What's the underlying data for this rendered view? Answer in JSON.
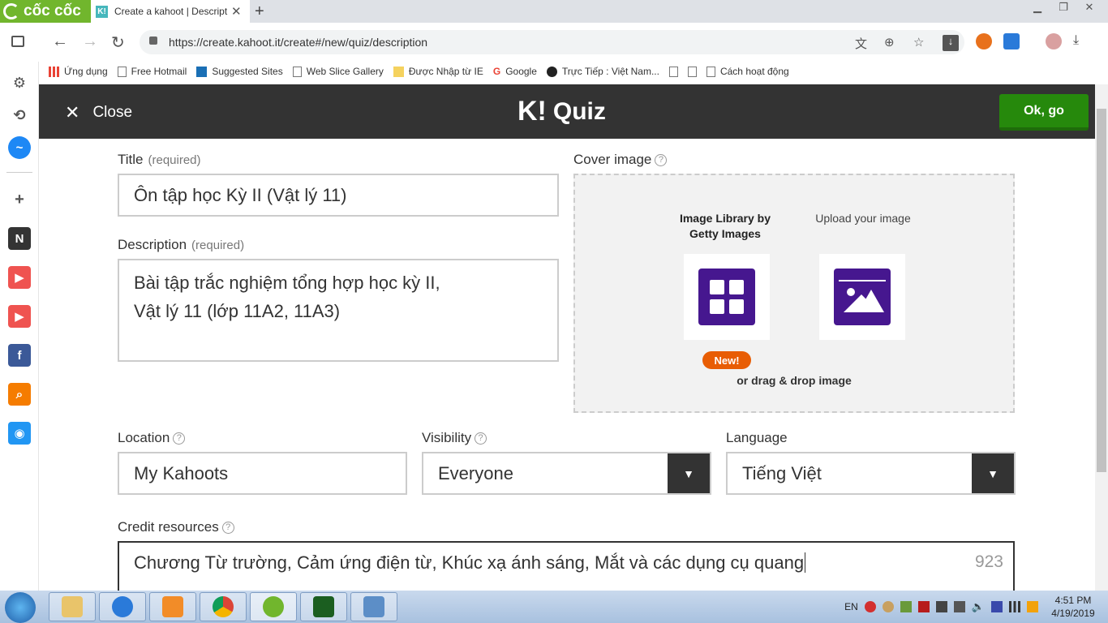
{
  "browser": {
    "brand": "cốc cốc",
    "tab_title": "Create a kahoot | Descript",
    "tab_favicon": "K!",
    "url": "https://create.kahoot.it/create#/new/quiz/description",
    "bookmarks": [
      {
        "label": "Ứng dụng",
        "icon": "apps-grid-icon"
      },
      {
        "label": "Free Hotmail",
        "icon": "page-icon"
      },
      {
        "label": "Suggested Sites",
        "icon": "bing-icon"
      },
      {
        "label": "Web Slice Gallery",
        "icon": "page-icon"
      },
      {
        "label": "Được Nhập từ IE",
        "icon": "folder-icon"
      },
      {
        "label": "Google",
        "icon": "google-icon"
      },
      {
        "label": "Trực Tiếp : Việt Nam...",
        "icon": "soccer-ball-icon"
      },
      {
        "label": "",
        "icon": "page-icon"
      },
      {
        "label": "",
        "icon": "page-icon"
      },
      {
        "label": "Cách hoạt động",
        "icon": "page-icon"
      }
    ]
  },
  "header": {
    "close_label": "Close",
    "logo_text": "Quiz",
    "ok_label": "Ok, go"
  },
  "form": {
    "title_label": "Title",
    "title_req": "(required)",
    "title_value": "Ôn tập học Kỳ II (Vật lý 11)",
    "description_label": "Description",
    "description_req": "(required)",
    "description_line1": "Bài tập trắc nghiệm tổng hợp học kỳ II,",
    "description_line2": "Vật lý 11 (lớp 11A2, 11A3)",
    "cover_label": "Cover image",
    "cover_library": "Image Library by Getty Images",
    "cover_upload": "Upload your image",
    "cover_new_badge": "New!",
    "cover_drag": "or drag & drop image",
    "location_label": "Location",
    "location_value": "My Kahoots",
    "visibility_label": "Visibility",
    "visibility_value": "Everyone",
    "language_label": "Language",
    "language_value": "Tiếng Việt",
    "credit_label": "Credit resources",
    "credit_value": "Chương Từ trường, Cảm ứng điện từ, Khúc xạ ánh sáng, Mắt và các dụng cụ quang",
    "credit_remaining": "923"
  },
  "taskbar": {
    "lang": "EN",
    "time": "4:51 PM",
    "date": "4/19/2019"
  },
  "colors": {
    "kahoot_header": "#333333",
    "ok_button": "#26890c",
    "accent_purple": "#46178f",
    "new_badge": "#e85d04"
  }
}
